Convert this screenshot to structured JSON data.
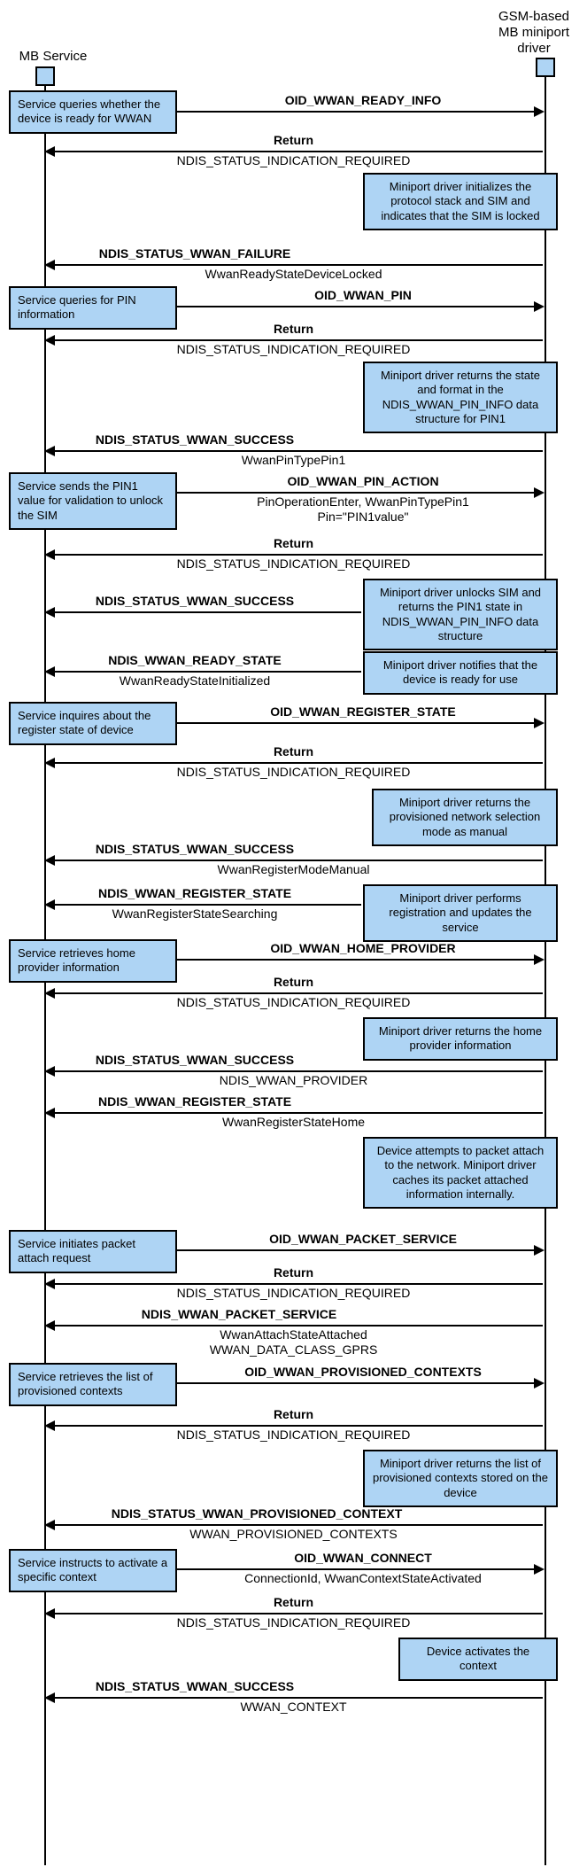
{
  "actors": {
    "left": "MB Service",
    "right": "GSM-based\nMB miniport\ndriver"
  },
  "notes": {
    "n1": "Service queries whether the device is ready for WWAN",
    "n2": "Miniport driver initializes the protocol stack and SIM and indicates that the SIM is locked",
    "n3": "Service queries for PIN information",
    "n4": "Miniport driver returns the state and format in the NDIS_WWAN_PIN_INFO data structure for PIN1",
    "n5": "Service sends the PIN1 value for validation to unlock the SIM",
    "n6": "Miniport driver unlocks SIM and returns the PIN1 state in  NDIS_WWAN_PIN_INFO data structure",
    "n7": "Miniport driver notifies that the device is ready for use",
    "n8": "Service inquires about the register state of device",
    "n9": "Miniport driver returns the provisioned network selection mode as manual",
    "n10": "Miniport driver performs registration and updates the service",
    "n11": "Service retrieves home provider information",
    "n12": "Miniport driver returns the home provider information",
    "n13": "Device attempts to packet attach to the network. Miniport driver caches its packet attached information internally.",
    "n14": "Service initiates packet attach request",
    "n15": "Service retrieves the list of provisioned contexts",
    "n16": "Miniport driver returns the list of provisioned contexts stored on the device",
    "n17": "Service instructs to activate a specific context",
    "n18": "Device activates the context"
  },
  "msgs": {
    "m1": "OID_WWAN_READY_INFO",
    "m2": "Return",
    "m2s": "NDIS_STATUS_INDICATION_REQUIRED",
    "m3": "NDIS_STATUS_WWAN_FAILURE",
    "m3s": "WwanReadyStateDeviceLocked",
    "m4": "OID_WWAN_PIN",
    "m5": "Return",
    "m5s": "NDIS_STATUS_INDICATION_REQUIRED",
    "m6": "NDIS_STATUS_WWAN_SUCCESS",
    "m6s": "WwanPinTypePin1",
    "m7": "OID_WWAN_PIN_ACTION",
    "m7s1": "PinOperationEnter, WwanPinTypePin1",
    "m7s2": "Pin=\"PIN1value\"",
    "m8": "Return",
    "m8s": "NDIS_STATUS_INDICATION_REQUIRED",
    "m9": "NDIS_STATUS_WWAN_SUCCESS",
    "m10": "NDIS_WWAN_READY_STATE",
    "m10s": "WwanReadyStateInitialized",
    "m11": "OID_WWAN_REGISTER_STATE",
    "m12": "Return",
    "m12s": "NDIS_STATUS_INDICATION_REQUIRED",
    "m13": "NDIS_STATUS_WWAN_SUCCESS",
    "m13s": "WwanRegisterModeManual",
    "m14": "NDIS_WWAN_REGISTER_STATE",
    "m14s": "WwanRegisterStateSearching",
    "m15": "OID_WWAN_HOME_PROVIDER",
    "m16": "Return",
    "m16s": "NDIS_STATUS_INDICATION_REQUIRED",
    "m17": "NDIS_STATUS_WWAN_SUCCESS",
    "m17s": "NDIS_WWAN_PROVIDER",
    "m18": "NDIS_WWAN_REGISTER_STATE",
    "m18s": "WwanRegisterStateHome",
    "m19": "OID_WWAN_PACKET_SERVICE",
    "m20": "Return",
    "m20s": "NDIS_STATUS_INDICATION_REQUIRED",
    "m21": "NDIS_WWAN_PACKET_SERVICE",
    "m21s1": "WwanAttachStateAttached",
    "m21s2": "WWAN_DATA_CLASS_GPRS",
    "m22": "OID_WWAN_PROVISIONED_CONTEXTS",
    "m23": "Return",
    "m23s": "NDIS_STATUS_INDICATION_REQUIRED",
    "m24": "NDIS_STATUS_WWAN_PROVISIONED_CONTEXT",
    "m24s": "WWAN_PROVISIONED_CONTEXTS",
    "m25": "OID_WWAN_CONNECT",
    "m25s": "ConnectionId, WwanContextStateActivated",
    "m26": "Return",
    "m26s": "NDIS_STATUS_INDICATION_REQUIRED",
    "m27": "NDIS_STATUS_WWAN_SUCCESS",
    "m27s": "WWAN_CONTEXT"
  }
}
